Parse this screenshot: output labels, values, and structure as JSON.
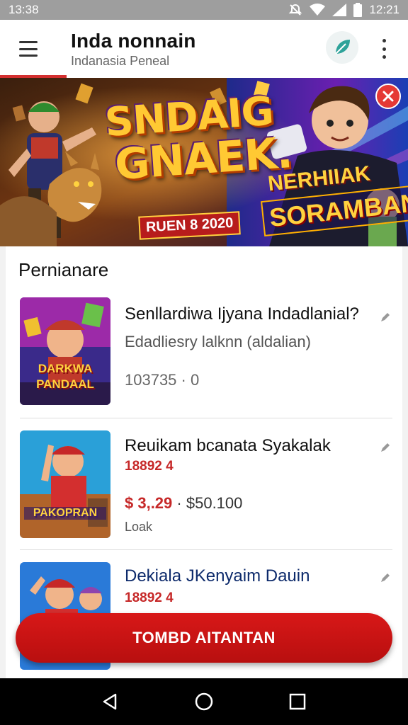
{
  "status_bar": {
    "time_left": "13:38",
    "time_right": "12:21"
  },
  "app_bar": {
    "title": "Inda nonnain",
    "subtitle": "Indanasia Peneal"
  },
  "banner": {
    "headline_line1": "SNDAIG",
    "headline_line2": "GNAEK.",
    "tagline_line1": "NERHIIAK",
    "tagline_line2": "SORAMBAN",
    "date_tag": "RUEN 8 2020"
  },
  "section": {
    "title": "Pernianare"
  },
  "items": [
    {
      "name": "Senllardiwa Ijyana Indadlanial?",
      "description": "Edadliesry lalknn (aldalian)",
      "meta": "103735 · 0",
      "thumb_text": "DARKWA PANDAAL"
    },
    {
      "name": "Reuikam bcanata Syakalak",
      "code": "18892 4",
      "price_red": "$ 3,.29",
      "price_separator": "·",
      "price_black": "$50.100",
      "label": "Loak",
      "thumb_text": "PAKOPRAN"
    },
    {
      "name": "Dekiala JKenyaim Dauin",
      "code": "18892 4"
    }
  ],
  "cta": {
    "label": "TOMBD AITANTAN"
  },
  "colors": {
    "accent": "#d32f2f",
    "cta": "#c81414"
  }
}
